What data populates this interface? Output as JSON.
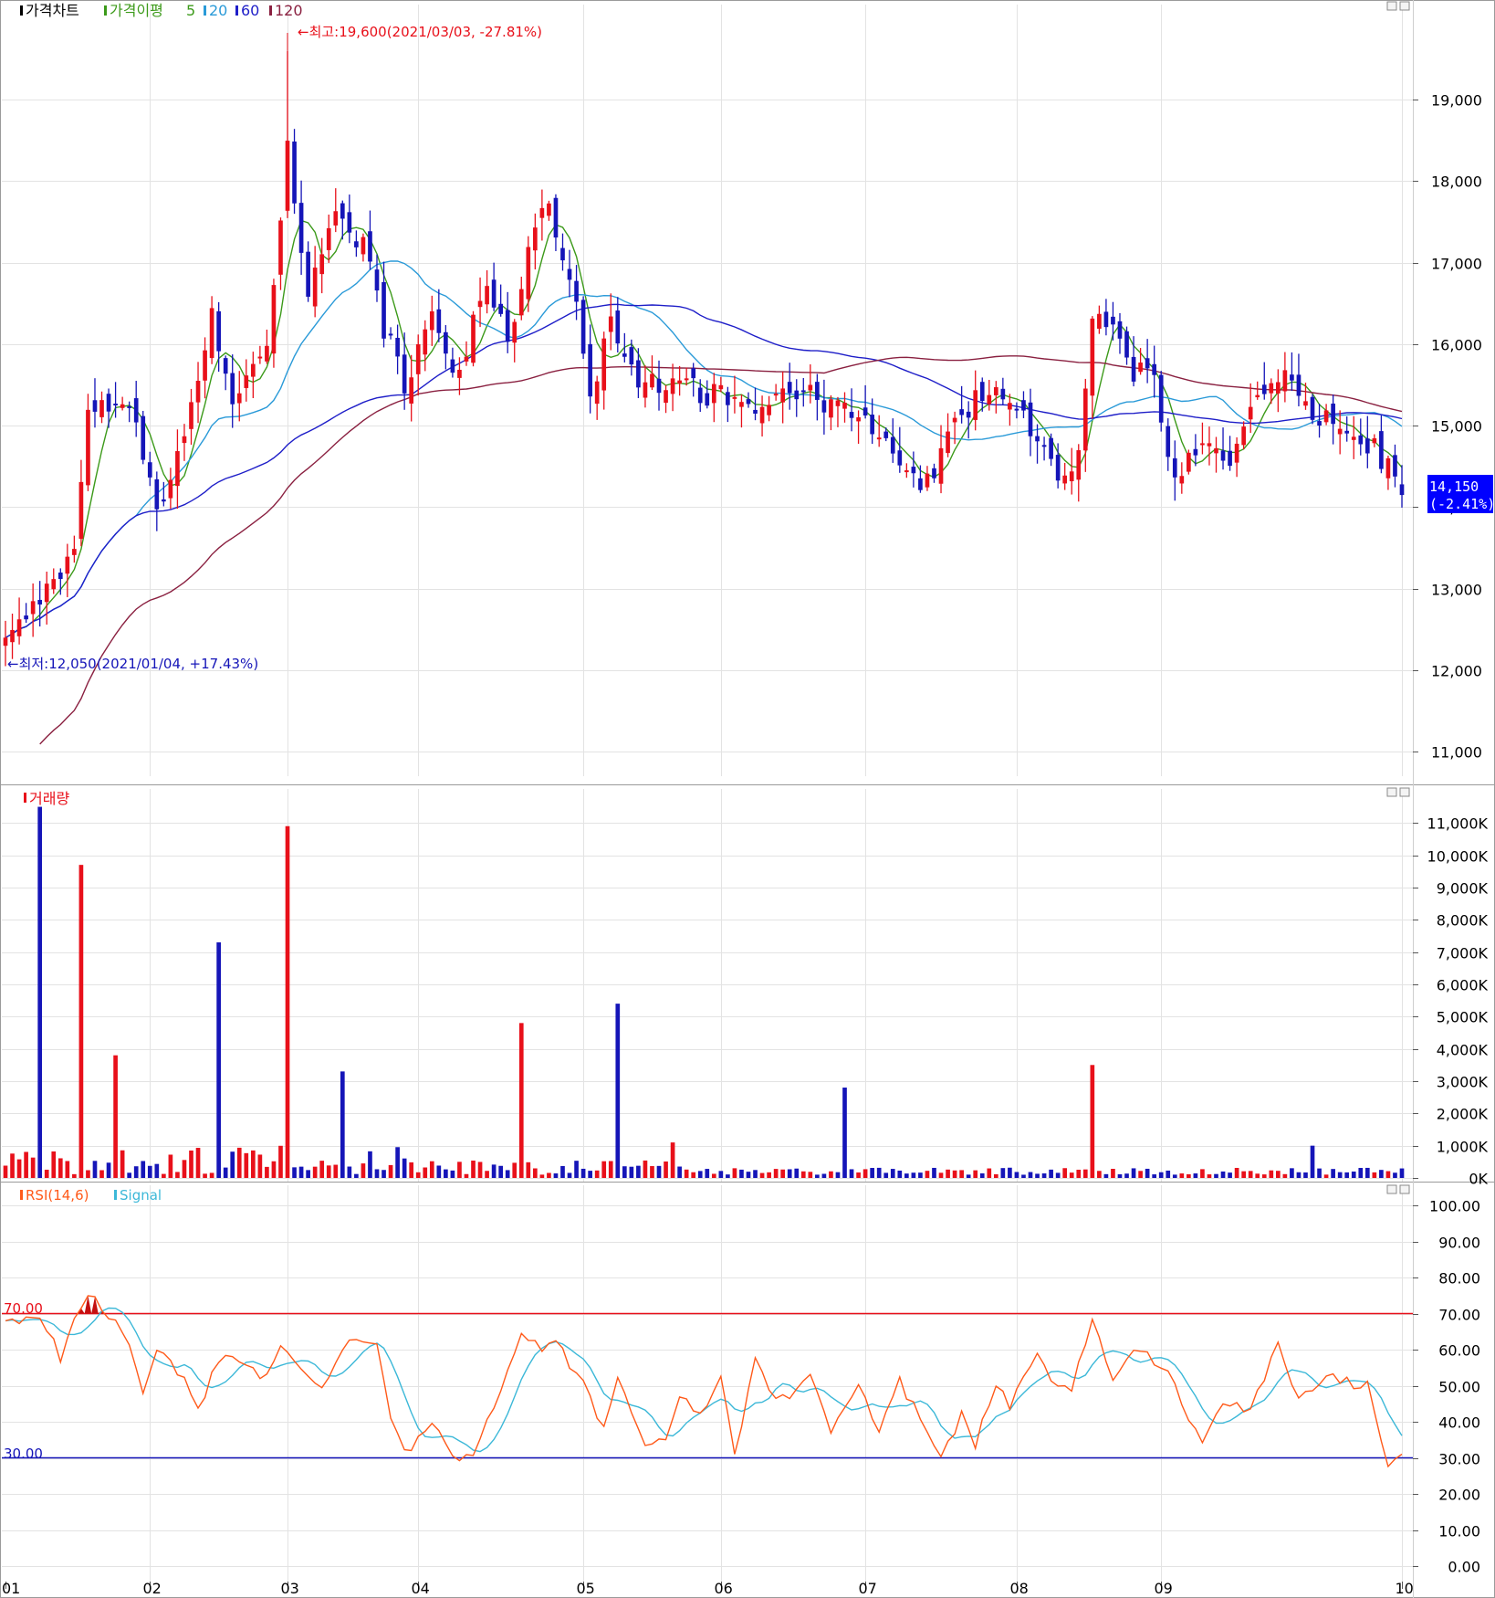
{
  "colors": {
    "up": "#e8101a",
    "down": "#1515b8",
    "ma5": "#3c9a1a",
    "ma20": "#2a9ad8",
    "ma60": "#1e1ec8",
    "ma120": "#8a2040",
    "grid": "#e3e3e3",
    "rsi": "#ff5a1a",
    "signal": "#3cb8d8",
    "last_price_bg": "#0000ff"
  },
  "price_panel": {
    "legend": {
      "chart": "가격차트",
      "ma": "가격이평",
      "p5": "5",
      "p20": "20",
      "p60": "60",
      "p120": "120"
    },
    "high_annotation": "←최고:19,600(2021/03/03, -27.81%)",
    "low_annotation": "←최저:12,050(2021/01/04, +17.43%)",
    "last_price": "14,150",
    "last_change": "(-2.41%)"
  },
  "volume_panel": {
    "title": "거래량"
  },
  "rsi_panel": {
    "title": "RSI(14,6)",
    "signal_label": "Signal",
    "upper_label": "70.00",
    "lower_label": "30.00"
  },
  "chart_data": [
    {
      "type": "candlestick",
      "title": "가격차트",
      "x_months": [
        "01",
        "02",
        "03",
        "04",
        "05",
        "06",
        "07",
        "08",
        "09",
        "10"
      ],
      "y_ticks": [
        "11,000",
        "12,000",
        "13,000",
        "14,000",
        "15,000",
        "16,000",
        "17,000",
        "18,000",
        "19,000"
      ],
      "ylim": [
        10700,
        20000
      ],
      "high": {
        "value": 19600,
        "date": "2021/03/03"
      },
      "low": {
        "value": 12050,
        "date": "2021/01/04"
      },
      "last": 14150,
      "last_change_pct": -2.41,
      "moving_averages": [
        5,
        20,
        60,
        120
      ],
      "close_anchors": [
        [
          0,
          12400
        ],
        [
          5,
          12800
        ],
        [
          10,
          13400
        ],
        [
          12,
          15200
        ],
        [
          18,
          15300
        ],
        [
          22,
          13900
        ],
        [
          25,
          14600
        ],
        [
          30,
          16400
        ],
        [
          33,
          15400
        ],
        [
          38,
          15900
        ],
        [
          41,
          18400
        ],
        [
          44,
          16700
        ],
        [
          48,
          17500
        ],
        [
          52,
          17200
        ],
        [
          55,
          16200
        ],
        [
          58,
          15500
        ],
        [
          62,
          16500
        ],
        [
          65,
          15500
        ],
        [
          70,
          16700
        ],
        [
          73,
          16000
        ],
        [
          76,
          17200
        ],
        [
          79,
          17700
        ],
        [
          82,
          16900
        ],
        [
          85,
          15300
        ],
        [
          88,
          16500
        ],
        [
          90,
          15700
        ],
        [
          94,
          15500
        ],
        [
          98,
          15500
        ],
        [
          102,
          15400
        ],
        [
          106,
          15300
        ],
        [
          110,
          15300
        ],
        [
          114,
          15400
        ],
        [
          118,
          15350
        ],
        [
          122,
          15200
        ],
        [
          126,
          15050
        ],
        [
          130,
          14600
        ],
        [
          133,
          14200
        ],
        [
          136,
          14650
        ],
        [
          139,
          15200
        ],
        [
          143,
          15400
        ],
        [
          147,
          15200
        ],
        [
          151,
          14800
        ],
        [
          154,
          14300
        ],
        [
          156,
          14700
        ],
        [
          158,
          16400
        ],
        [
          161,
          16200
        ],
        [
          164,
          15700
        ],
        [
          167,
          15500
        ],
        [
          170,
          14300
        ],
        [
          174,
          14850
        ],
        [
          178,
          14650
        ],
        [
          182,
          15300
        ],
        [
          186,
          15700
        ],
        [
          190,
          15200
        ],
        [
          194,
          15000
        ],
        [
          198,
          14750
        ],
        [
          202,
          14500
        ],
        [
          203,
          14150
        ]
      ]
    },
    {
      "type": "bar",
      "title": "거래량",
      "y_ticks": [
        "0K",
        "1,000K",
        "2,000K",
        "3,000K",
        "4,000K",
        "5,000K",
        "6,000K",
        "7,000K",
        "8,000K",
        "9,000K",
        "10,000K",
        "11,000K"
      ],
      "ylim": [
        0,
        11600
      ],
      "spikes": [
        [
          5,
          11500
        ],
        [
          11,
          9700
        ],
        [
          16,
          3800
        ],
        [
          31,
          7300
        ],
        [
          41,
          10900
        ],
        [
          49,
          3300
        ],
        [
          75,
          4800
        ],
        [
          89,
          5400
        ],
        [
          97,
          1100
        ],
        [
          122,
          2800
        ],
        [
          158,
          3500
        ],
        [
          190,
          1000
        ]
      ],
      "base_volume_k": 250
    },
    {
      "type": "line",
      "title": "RSI(14,6)",
      "series": [
        {
          "name": "RSI(14,6)",
          "color": "#ff5a1a"
        },
        {
          "name": "Signal",
          "color": "#3cb8d8"
        }
      ],
      "y_ticks": [
        "0.00",
        "10.00",
        "20.00",
        "30.00",
        "40.00",
        "50.00",
        "60.00",
        "70.00",
        "80.00",
        "90.00",
        "100.00"
      ],
      "ylim": [
        0,
        100
      ],
      "levels": [
        70,
        30
      ],
      "rsi_anchors": [
        [
          0,
          68
        ],
        [
          5,
          69
        ],
        [
          8,
          58
        ],
        [
          10,
          68
        ],
        [
          12,
          75
        ],
        [
          15,
          70
        ],
        [
          18,
          62
        ],
        [
          20,
          48
        ],
        [
          22,
          61
        ],
        [
          26,
          52
        ],
        [
          28,
          43
        ],
        [
          31,
          57
        ],
        [
          34,
          58
        ],
        [
          37,
          52
        ],
        [
          40,
          60
        ],
        [
          43,
          56
        ],
        [
          46,
          48
        ],
        [
          50,
          62
        ],
        [
          54,
          63
        ],
        [
          56,
          40
        ],
        [
          58,
          31
        ],
        [
          62,
          39
        ],
        [
          65,
          31
        ],
        [
          68,
          30
        ],
        [
          72,
          50
        ],
        [
          75,
          64
        ],
        [
          78,
          60
        ],
        [
          80,
          62
        ],
        [
          84,
          50
        ],
        [
          87,
          38
        ],
        [
          89,
          53
        ],
        [
          93,
          33
        ],
        [
          96,
          36
        ],
        [
          98,
          47
        ],
        [
          101,
          41
        ],
        [
          104,
          53
        ],
        [
          106,
          30
        ],
        [
          109,
          57
        ],
        [
          111,
          48
        ],
        [
          114,
          47
        ],
        [
          117,
          53
        ],
        [
          120,
          38
        ],
        [
          124,
          51
        ],
        [
          127,
          37
        ],
        [
          130,
          51
        ],
        [
          134,
          38
        ],
        [
          136,
          29
        ],
        [
          139,
          42
        ],
        [
          141,
          34
        ],
        [
          144,
          51
        ],
        [
          146,
          44
        ],
        [
          150,
          60
        ],
        [
          152,
          52
        ],
        [
          155,
          50
        ],
        [
          158,
          68
        ],
        [
          161,
          52
        ],
        [
          164,
          60
        ],
        [
          168,
          56
        ],
        [
          170,
          50
        ],
        [
          174,
          33
        ],
        [
          177,
          45
        ],
        [
          181,
          43
        ],
        [
          185,
          62
        ],
        [
          188,
          46
        ],
        [
          192,
          53
        ],
        [
          195,
          51
        ],
        [
          198,
          50
        ],
        [
          201,
          29
        ],
        [
          203,
          31
        ]
      ]
    }
  ]
}
